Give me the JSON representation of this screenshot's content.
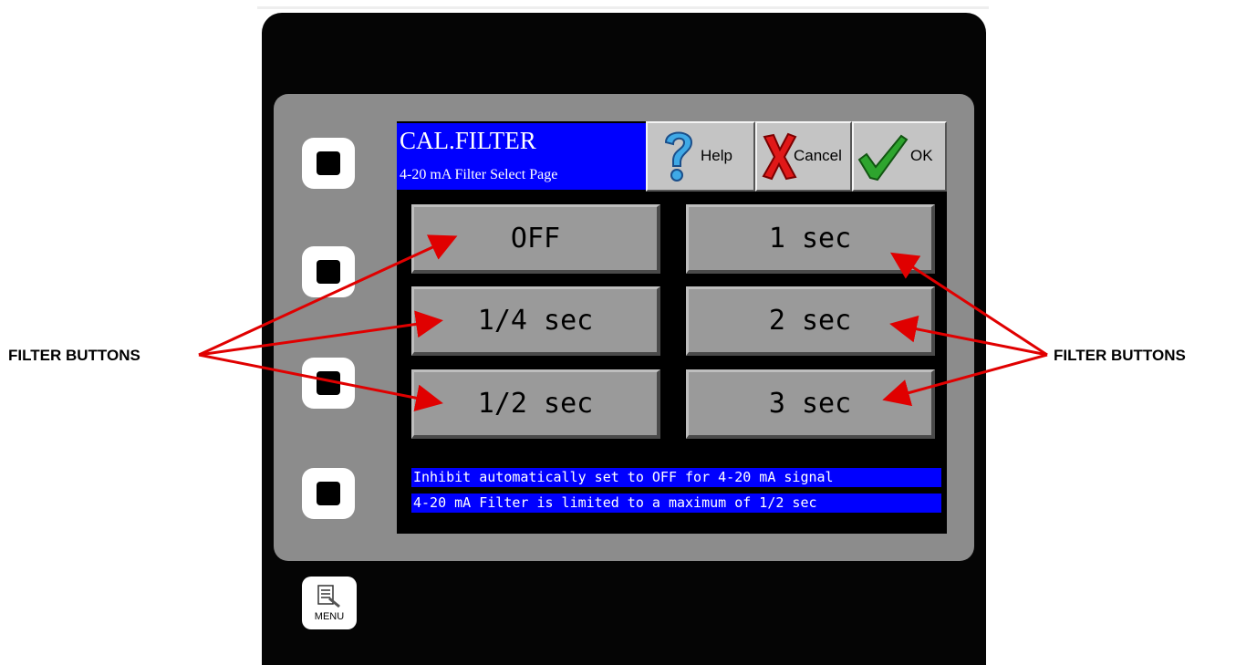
{
  "header": {
    "title": "CAL.FILTER",
    "subtitle": "4-20 mA Filter Select Page"
  },
  "toolbar": {
    "help_label": "Help",
    "cancel_label": "Cancel",
    "ok_label": "OK"
  },
  "filter_buttons": {
    "off": "OFF",
    "quarter": "1/4 sec",
    "half": "1/2 sec",
    "one": "1 sec",
    "two": "2 sec",
    "three": "3 sec"
  },
  "messages": [
    "Inhibit automatically set to OFF for 4-20 mA signal",
    "4-20 mA Filter is limited to a maximum of 1/2 sec"
  ],
  "menu": {
    "label": "MENU"
  },
  "callouts": {
    "left": "FILTER BUTTONS",
    "right": "FILTER BUTTONS"
  },
  "colors": {
    "title_bg": "#0000ff",
    "message_bg": "#0000ff",
    "arrow": "#e00000",
    "button_face": "#9a9a9a"
  },
  "icons": {
    "help": "question-mark-icon",
    "cancel": "red-x-icon",
    "ok": "green-check-icon",
    "menu": "menu-icon"
  }
}
